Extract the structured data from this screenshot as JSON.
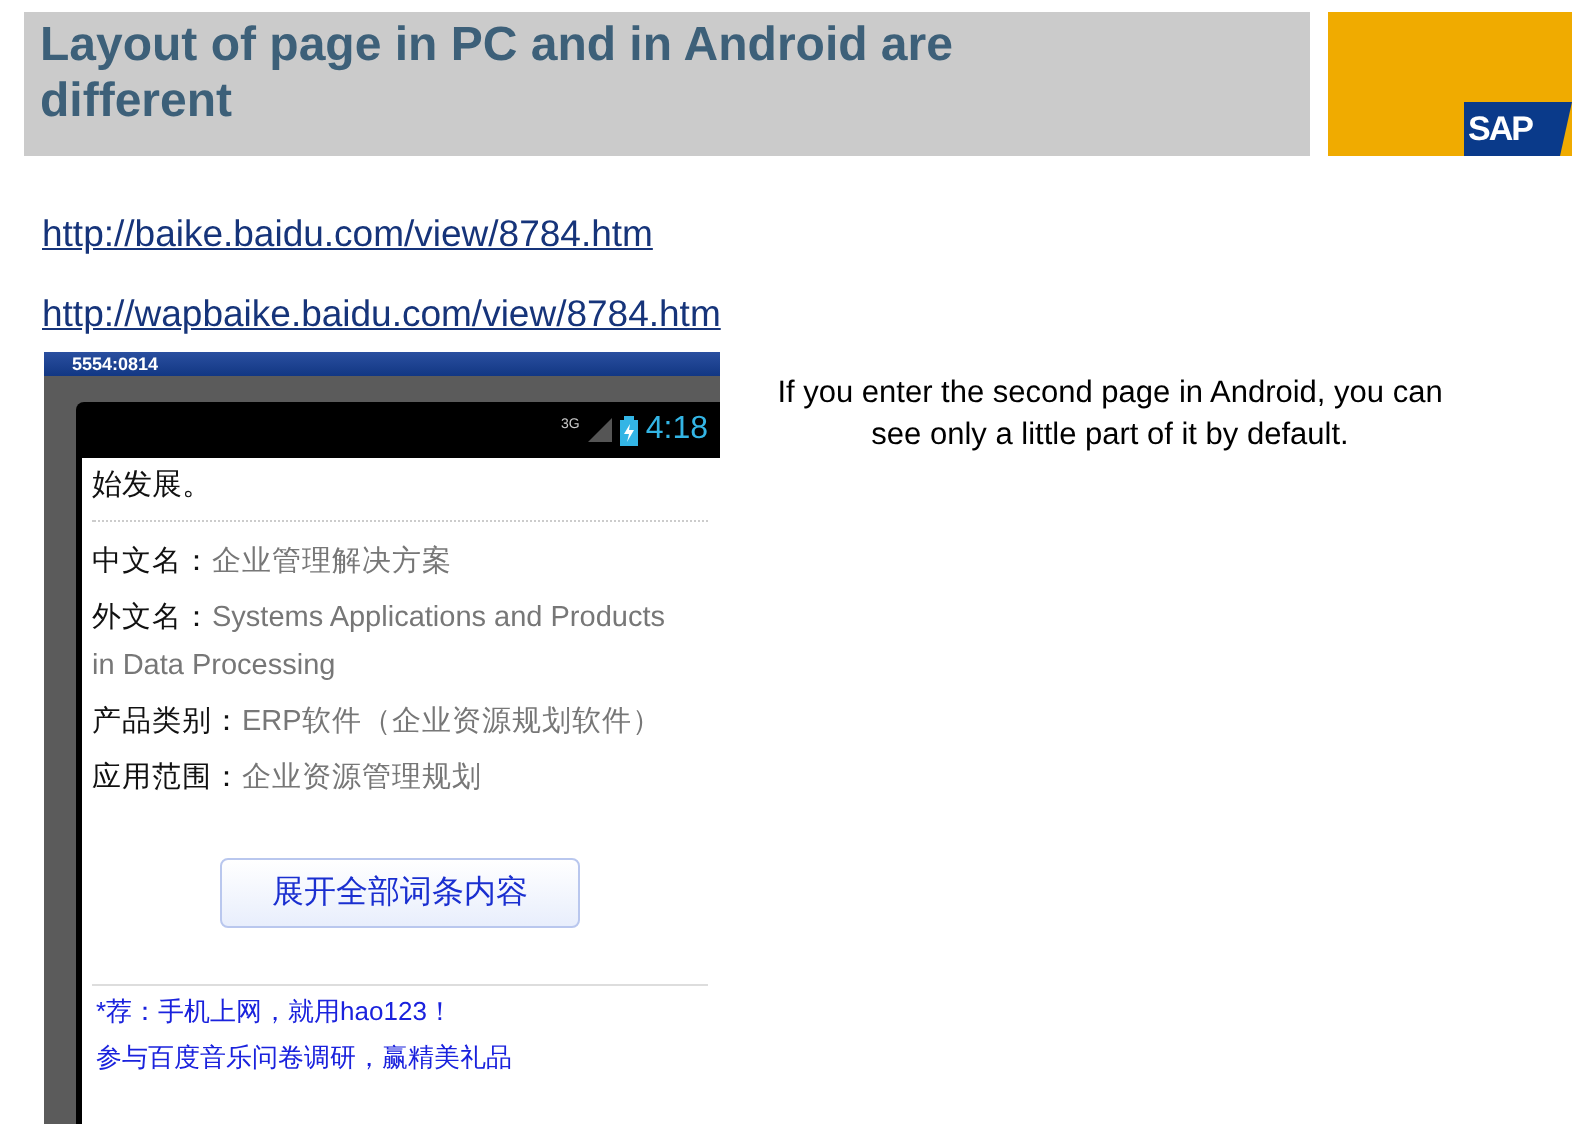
{
  "title": "Layout of page in PC and in Android are different",
  "logo": "SAP",
  "links": [
    "http://baike.baidu.com/view/8784.htm",
    "http://wapbaike.baidu.com/view/8784.htm"
  ],
  "phone": {
    "window_title": "5554:0814",
    "network": "3G",
    "time": "4:18",
    "intro": "始发展。",
    "fields": [
      {
        "label": "中文名：",
        "value": "企业管理解决方案"
      },
      {
        "label": "外文名：",
        "value": "Systems Applications and Products in Data Processing"
      },
      {
        "label": "产品类别：",
        "value": "ERP软件（企业资源规划软件）"
      },
      {
        "label": "应用范围：",
        "value": "企业资源管理规划"
      }
    ],
    "expand_button": "展开全部词条内容",
    "footer_links": [
      "*荐：手机上网，就用hao123！",
      "参与百度音乐问卷调研，赢精美礼品"
    ]
  },
  "note": "If you enter the second page in Android, you can see only a little part of it by default."
}
